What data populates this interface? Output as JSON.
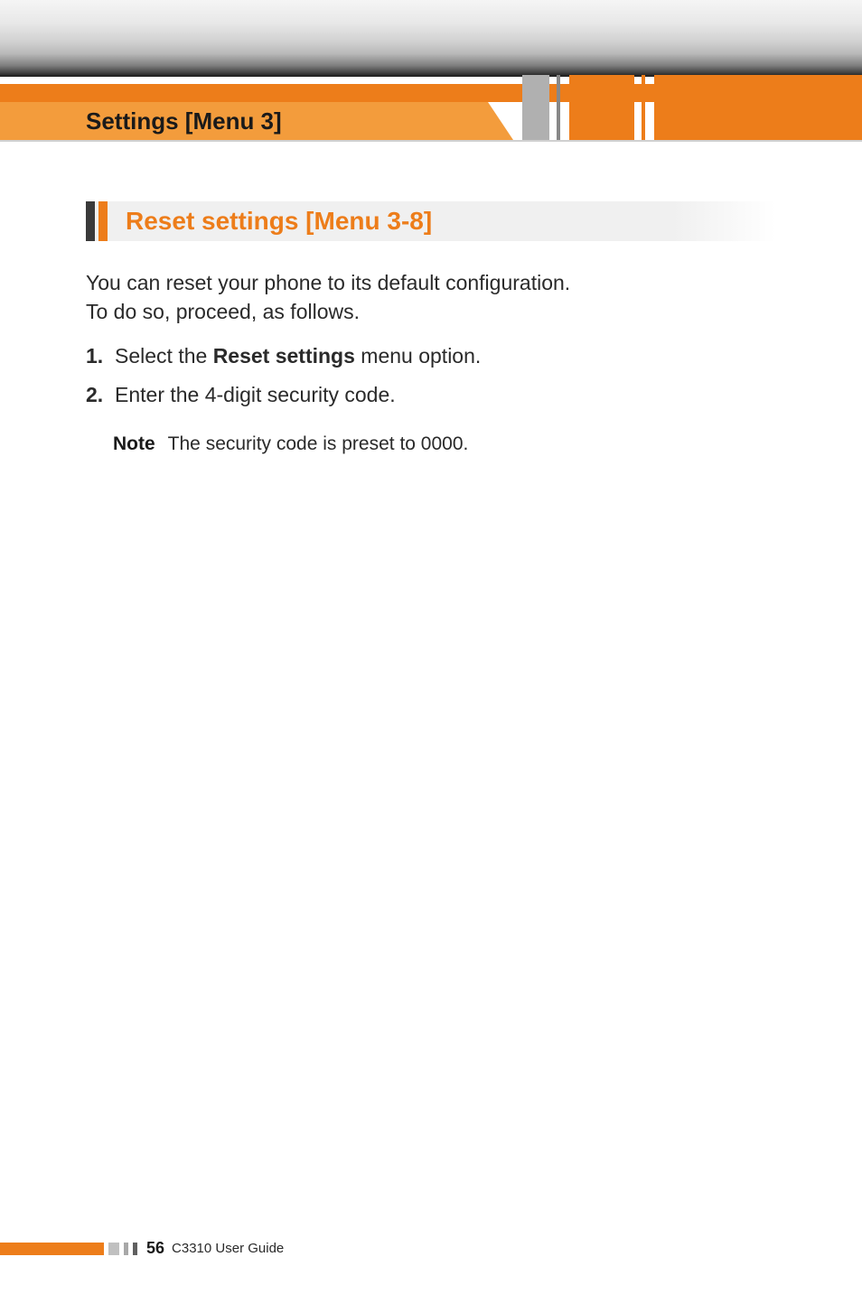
{
  "header": {
    "breadcrumb": "Settings [Menu 3]"
  },
  "section": {
    "heading": "Reset settings [Menu 3-8]",
    "intro_line1": "You can reset your phone to its default configuration.",
    "intro_line2": "To do so, proceed, as follows.",
    "steps": [
      {
        "num": "1.",
        "prefix": "Select the ",
        "bold": "Reset settings",
        "suffix": " menu option."
      },
      {
        "num": "2.",
        "prefix": "Enter the 4-digit security code.",
        "bold": "",
        "suffix": ""
      }
    ],
    "note_label": "Note",
    "note_text": "The security code is preset to 0000."
  },
  "footer": {
    "page_number": "56",
    "guide_label": "C3310 User Guide"
  }
}
